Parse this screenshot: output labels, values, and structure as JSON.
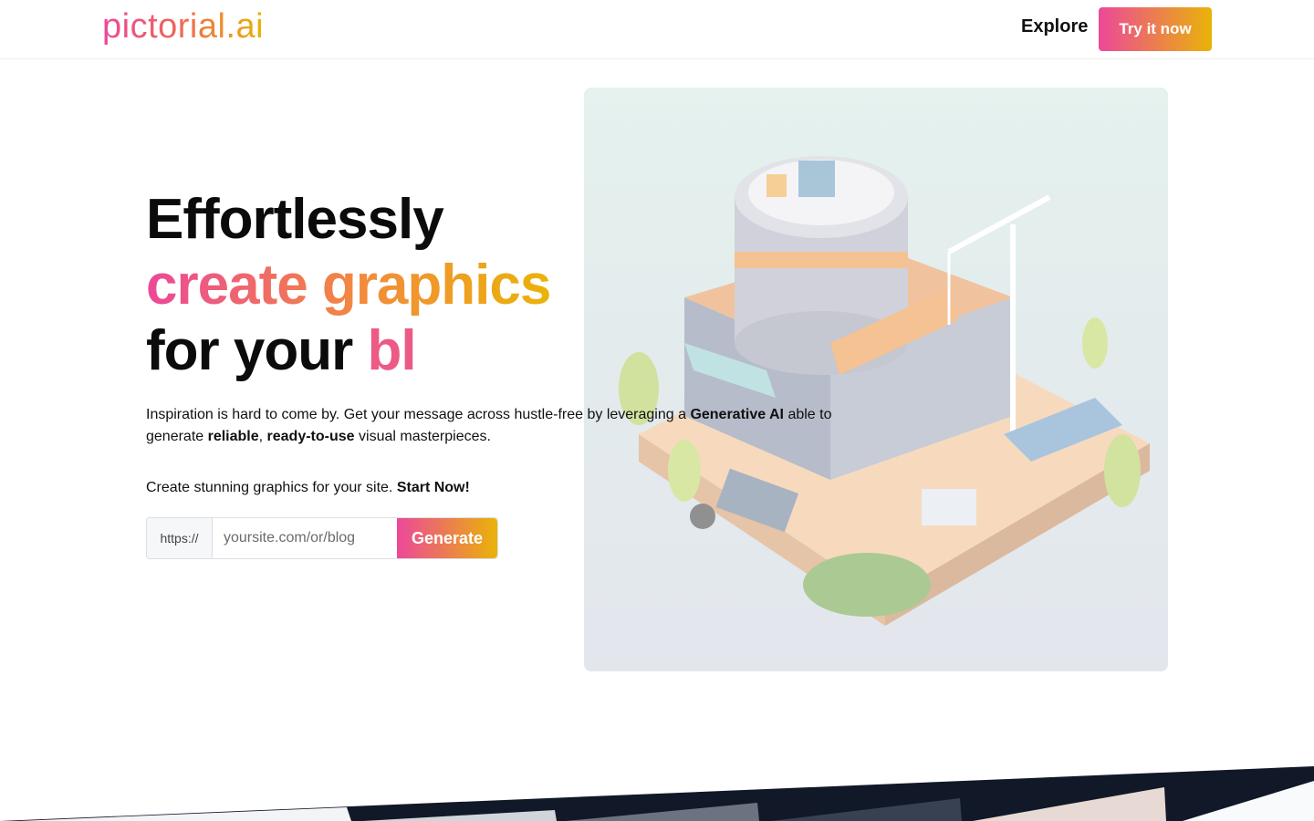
{
  "nav": {
    "logo": "pictorial.ai",
    "explore_label": "Explore",
    "cta_label": "Try it now"
  },
  "hero": {
    "headline_line1": "Effortlessly",
    "headline_line2": "create graphics",
    "headline_line3_prefix": "for your ",
    "headline_line3_typed": "bl",
    "desc_part1": "Inspiration is hard to come by. Get your message across hustle-free by leveraging a ",
    "desc_bold1": "Generative AI",
    "desc_part2": " able to generate ",
    "desc_bold2": "reliable",
    "desc_part3": ", ",
    "desc_bold3": "ready-to-use",
    "desc_part4": " visual masterpieces.",
    "cta_text": "Create stunning graphics for your site. ",
    "cta_bold": "Start Now!"
  },
  "form": {
    "prefix": "https://",
    "placeholder": "yoursite.com/or/blog",
    "button_label": "Generate"
  },
  "colors": {
    "gradient_start": "#ec4899",
    "gradient_end": "#eab308"
  }
}
